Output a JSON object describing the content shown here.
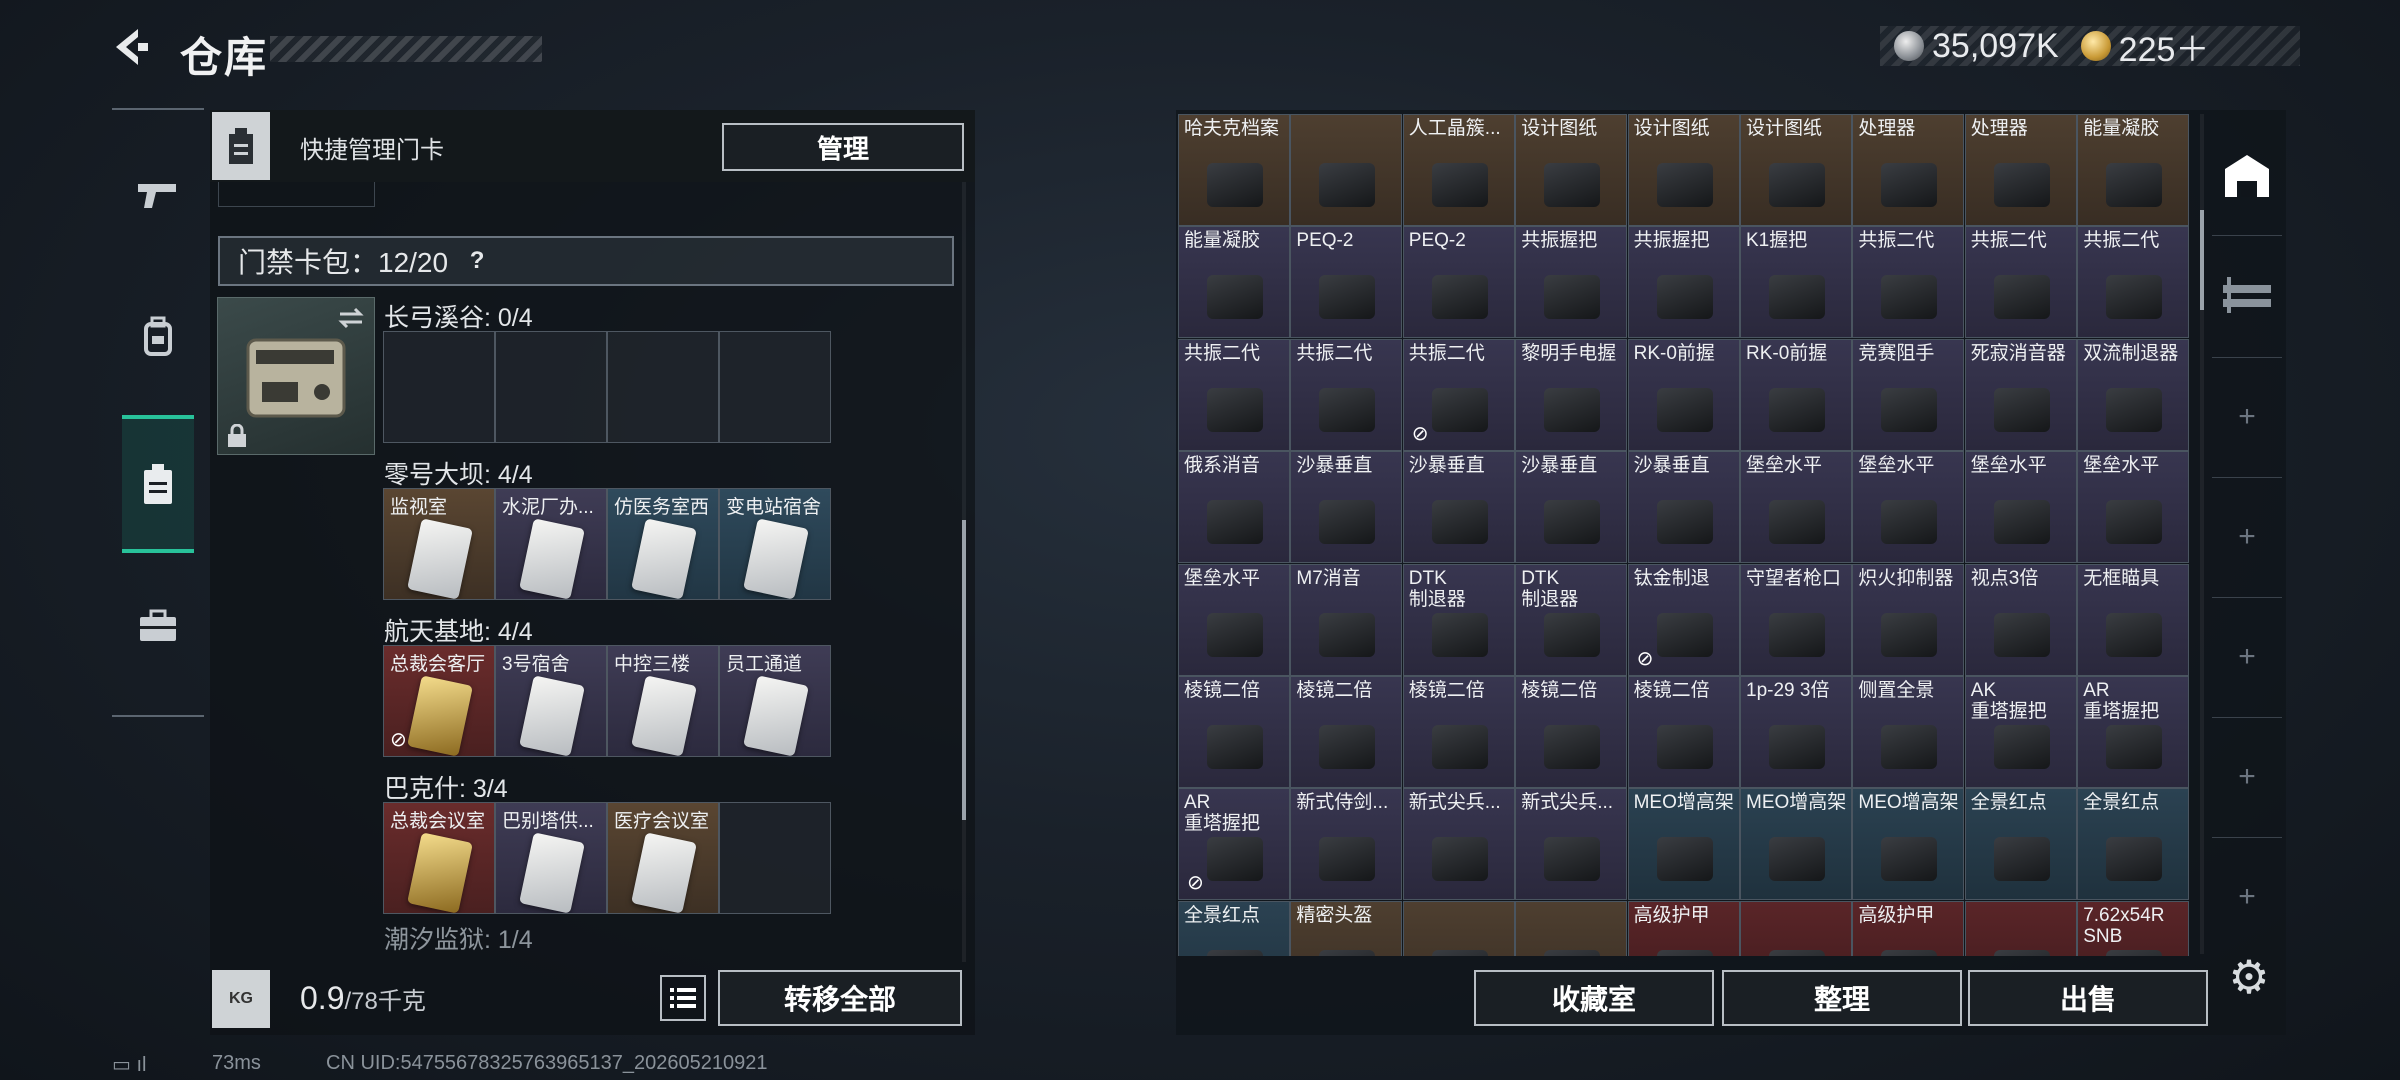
{
  "header": {
    "title": "仓库"
  },
  "currency": {
    "silver": "35,097K",
    "gold": "225＋"
  },
  "side_nav": [
    "pistol-icon",
    "backpack-icon",
    "keycard-icon",
    "toolbox-icon"
  ],
  "left": {
    "head_label": "快捷管理门卡",
    "manage_label": "管理",
    "pack_label": "门禁卡包：12/20",
    "pack_help": "?",
    "zones": [
      {
        "name": "长弓溪谷: 0/4",
        "slots": [
          {
            "label": "",
            "color": "empty"
          },
          {
            "label": "",
            "color": "empty"
          },
          {
            "label": "",
            "color": "empty"
          },
          {
            "label": "",
            "color": "empty"
          }
        ]
      },
      {
        "name": "零号大坝: 4/4",
        "slots": [
          {
            "label": "监视室",
            "color": "brown"
          },
          {
            "label": "水泥厂办...",
            "color": "purple"
          },
          {
            "label": "仿医务室西",
            "color": "blue"
          },
          {
            "label": "变电站宿舍",
            "color": "blue"
          }
        ]
      },
      {
        "name": "航天基地: 4/4",
        "slots": [
          {
            "label": "总裁会客厅",
            "color": "red",
            "gold": true,
            "nocard": true
          },
          {
            "label": "3号宿舍",
            "color": "purple"
          },
          {
            "label": "中控三楼",
            "color": "purple"
          },
          {
            "label": "员工通道",
            "color": "purple"
          }
        ]
      },
      {
        "name": "巴克什: 3/4",
        "slots": [
          {
            "label": "总裁会议室",
            "color": "red",
            "gold": true
          },
          {
            "label": "巴别塔供...",
            "color": "purple"
          },
          {
            "label": "医疗会议室",
            "color": "brown"
          },
          {
            "label": "",
            "color": "empty"
          }
        ]
      }
    ],
    "partial_zone": "潮汐监狱: 1/4",
    "weight_icon": "KG",
    "weight_value": "0.9",
    "weight_unit": "/78千克",
    "transfer_label": "转移全部"
  },
  "grid": [
    [
      {
        "l": "哈夫克档案",
        "c": "brown"
      },
      {
        "l": "",
        "c": "brown"
      },
      {
        "l": "人工晶簇...",
        "c": "brown"
      },
      {
        "l": "设计图纸",
        "c": "brown"
      },
      {
        "l": "设计图纸",
        "c": "brown"
      },
      {
        "l": "设计图纸",
        "c": "brown"
      },
      {
        "l": "处理器",
        "c": "brown"
      },
      {
        "l": "处理器",
        "c": "brown"
      },
      {
        "l": "能量凝胶",
        "c": "brown"
      }
    ],
    [
      {
        "l": "能量凝胶",
        "c": "purple"
      },
      {
        "l": "PEQ-2",
        "c": "purple"
      },
      {
        "l": "PEQ-2",
        "c": "purple"
      },
      {
        "l": "共振握把",
        "c": "purple"
      },
      {
        "l": "共振握把",
        "c": "purple"
      },
      {
        "l": "K1握把",
        "c": "purple"
      },
      {
        "l": "共振二代",
        "c": "purple"
      },
      {
        "l": "共振二代",
        "c": "purple"
      },
      {
        "l": "共振二代",
        "c": "purple"
      }
    ],
    [
      {
        "l": "共振二代",
        "c": "purple"
      },
      {
        "l": "共振二代",
        "c": "purple"
      },
      {
        "l": "共振二代",
        "c": "purple",
        "x": true
      },
      {
        "l": "黎明手电握",
        "c": "purple"
      },
      {
        "l": "RK-0前握",
        "c": "purple"
      },
      {
        "l": "RK-0前握",
        "c": "purple"
      },
      {
        "l": "竞赛阻手",
        "c": "purple"
      },
      {
        "l": "死寂消音器",
        "c": "purple"
      },
      {
        "l": "双流制退器",
        "c": "purple"
      }
    ],
    [
      {
        "l": "俄系消音",
        "c": "purple"
      },
      {
        "l": "沙暴垂直",
        "c": "purple"
      },
      {
        "l": "沙暴垂直",
        "c": "purple"
      },
      {
        "l": "沙暴垂直",
        "c": "purple"
      },
      {
        "l": "沙暴垂直",
        "c": "purple"
      },
      {
        "l": "堡垒水平",
        "c": "purple"
      },
      {
        "l": "堡垒水平",
        "c": "purple"
      },
      {
        "l": "堡垒水平",
        "c": "purple"
      },
      {
        "l": "堡垒水平",
        "c": "purple"
      }
    ],
    [
      {
        "l": "堡垒水平",
        "c": "purple"
      },
      {
        "l": "M7消音",
        "c": "purple"
      },
      {
        "l": "DTK\n制退器",
        "c": "purple"
      },
      {
        "l": "DTK\n制退器",
        "c": "purple"
      },
      {
        "l": "钛金制退",
        "c": "purple",
        "x": true
      },
      {
        "l": "守望者枪口",
        "c": "purple"
      },
      {
        "l": "炽火抑制器",
        "c": "purple"
      },
      {
        "l": "视点3倍",
        "c": "purple"
      },
      {
        "l": "无框瞄具",
        "c": "purple"
      }
    ],
    [
      {
        "l": "棱镜二倍",
        "c": "purple"
      },
      {
        "l": "棱镜二倍",
        "c": "purple"
      },
      {
        "l": "棱镜二倍",
        "c": "purple"
      },
      {
        "l": "棱镜二倍",
        "c": "purple"
      },
      {
        "l": "棱镜二倍",
        "c": "purple"
      },
      {
        "l": "1p-29 3倍",
        "c": "purple"
      },
      {
        "l": "侧置全景",
        "c": "purple"
      },
      {
        "l": "AK\n重塔握把",
        "c": "purple"
      },
      {
        "l": "AR\n重塔握把",
        "c": "purple"
      }
    ],
    [
      {
        "l": "AR\n重塔握把",
        "c": "purple",
        "x": true
      },
      {
        "l": "新式侍剑...",
        "c": "purple"
      },
      {
        "l": "新式尖兵...",
        "c": "purple"
      },
      {
        "l": "新式尖兵...",
        "c": "purple"
      },
      {
        "l": "MEO增高架",
        "c": "blue"
      },
      {
        "l": "MEO增高架",
        "c": "blue"
      },
      {
        "l": "MEO增高架",
        "c": "blue"
      },
      {
        "l": "全景红点",
        "c": "blue"
      },
      {
        "l": "全景红点",
        "c": "blue"
      }
    ],
    [
      {
        "l": "全景红点",
        "c": "blue"
      },
      {
        "l": "精密头盔",
        "c": "brown"
      },
      {
        "l": "",
        "c": "brown"
      },
      {
        "l": "",
        "c": "brown"
      },
      {
        "l": "高级护甲",
        "c": "red"
      },
      {
        "l": "",
        "c": "red"
      },
      {
        "l": "高级护甲",
        "c": "red"
      },
      {
        "l": "",
        "c": "red"
      },
      {
        "l": "7.62x54R\nSNB",
        "c": "red"
      }
    ]
  ],
  "right_tabs": [
    "safehouse-icon",
    "collection-icon",
    "plus-icon",
    "plus-icon",
    "plus-icon",
    "plus-icon",
    "plus-icon"
  ],
  "bottom_buttons": {
    "collection": "收藏室",
    "sort": "整理",
    "sell": "出售"
  },
  "status": {
    "ping": "73ms",
    "uid": "CN UID:54755678325763965137_202605210921"
  }
}
